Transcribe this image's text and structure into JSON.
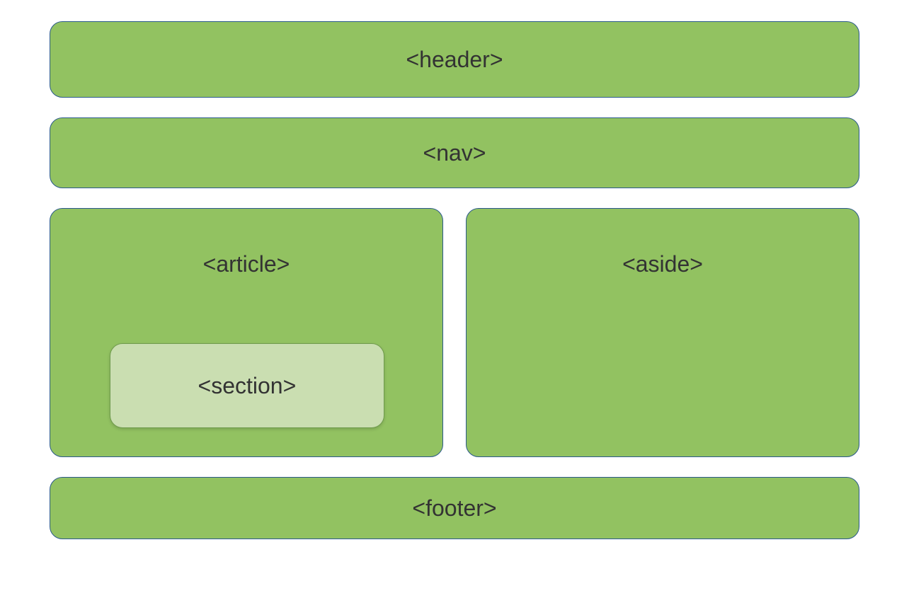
{
  "layout": {
    "header": "<header>",
    "nav": "<nav>",
    "article": "<article>",
    "section": "<section>",
    "aside": "<aside>",
    "footer": "<footer>"
  }
}
